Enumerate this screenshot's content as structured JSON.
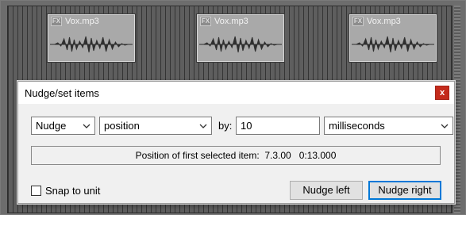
{
  "arrange": {
    "items": [
      {
        "name": "Vox.mp3",
        "fx_icon": "FX"
      },
      {
        "name": "Vox.mp3",
        "fx_icon": "FX"
      },
      {
        "name": "Vox.mp3",
        "fx_icon": "FX"
      }
    ]
  },
  "dialog": {
    "title": "Nudge/set items",
    "close_glyph": "x",
    "mode_select": "Nudge",
    "target_select": "position",
    "by_label": "by:",
    "amount_value": "10",
    "unit_select": "milliseconds",
    "status_text": "Position of first selected item:  7.3.00   0:13.000",
    "snap_label": "Snap to unit",
    "snap_checked": false,
    "nudge_left_label": "Nudge left",
    "nudge_right_label": "Nudge right"
  },
  "colors": {
    "close_button": "#c42b1c",
    "default_button_border": "#0078d7",
    "item_fill": "#a9a9a9",
    "track_background": "#5e5e5e"
  },
  "icons": [
    "fx-icon",
    "waveform-icon",
    "close-icon",
    "chevron-down-icon",
    "checkbox-icon"
  ]
}
